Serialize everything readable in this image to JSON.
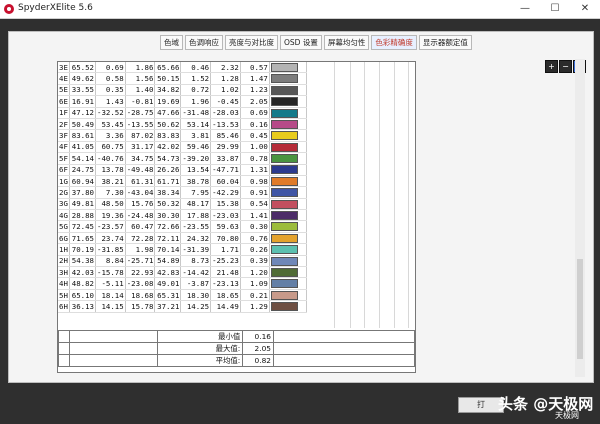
{
  "window": {
    "title": "SpyderXElite 5.6",
    "minimize": "—",
    "maximize": "☐",
    "close": "✕"
  },
  "tabs": [
    {
      "label": "色域"
    },
    {
      "label": "色调响应"
    },
    {
      "label": "亮度与对比度"
    },
    {
      "label": "OSD 设置"
    },
    {
      "label": "屏幕均匀性"
    },
    {
      "label": "色彩精确度",
      "active": true
    },
    {
      "label": "显示器额定值"
    }
  ],
  "zoom": {
    "in": "+",
    "out": "−",
    "fit": "⌕"
  },
  "table": {
    "rows": [
      {
        "id": "3E",
        "v": [
          "65.52",
          "0.69",
          "1.86",
          "65.66",
          "0.46",
          "2.32",
          "0.57"
        ],
        "swatch": "#b4b4b4"
      },
      {
        "id": "4E",
        "v": [
          "49.62",
          "0.58",
          "1.56",
          "50.15",
          "1.52",
          "1.28",
          "1.47"
        ],
        "swatch": "#7d7d7d"
      },
      {
        "id": "5E",
        "v": [
          "33.55",
          "0.35",
          "1.40",
          "34.82",
          "0.72",
          "1.02",
          "1.23"
        ],
        "swatch": "#575757"
      },
      {
        "id": "6E",
        "v": [
          "16.91",
          "1.43",
          "-0.81",
          "19.69",
          "1.96",
          "-0.45",
          "2.05"
        ],
        "swatch": "#262626"
      },
      {
        "id": "1F",
        "v": [
          "47.12",
          "-32.52",
          "-28.75",
          "47.66",
          "-31.48",
          "-28.03",
          "0.69"
        ],
        "swatch": "#137a8a"
      },
      {
        "id": "2F",
        "v": [
          "50.49",
          "53.45",
          "-13.55",
          "50.62",
          "53.14",
          "-13.53",
          "0.16"
        ],
        "swatch": "#b64a88"
      },
      {
        "id": "3F",
        "v": [
          "83.61",
          "3.36",
          "87.02",
          "83.83",
          "3.81",
          "85.46",
          "0.45"
        ],
        "swatch": "#e8cc1d"
      },
      {
        "id": "4F",
        "v": [
          "41.05",
          "60.75",
          "31.17",
          "42.02",
          "59.46",
          "29.99",
          "1.00"
        ],
        "swatch": "#b52b38"
      },
      {
        "id": "5F",
        "v": [
          "54.14",
          "-40.76",
          "34.75",
          "54.73",
          "-39.20",
          "33.87",
          "0.78"
        ],
        "swatch": "#4a9440"
      },
      {
        "id": "6F",
        "v": [
          "24.75",
          "13.78",
          "-49.48",
          "26.26",
          "13.54",
          "-47.71",
          "1.31"
        ],
        "swatch": "#2c3a8e"
      },
      {
        "id": "1G",
        "v": [
          "60.94",
          "38.21",
          "61.31",
          "61.71",
          "38.78",
          "60.04",
          "0.98"
        ],
        "swatch": "#e07b28"
      },
      {
        "id": "2G",
        "v": [
          "37.80",
          "7.30",
          "-43.04",
          "38.34",
          "7.95",
          "-42.29",
          "0.91"
        ],
        "swatch": "#3f55a5"
      },
      {
        "id": "3G",
        "v": [
          "49.81",
          "48.50",
          "15.76",
          "50.32",
          "48.17",
          "15.38",
          "0.54"
        ],
        "swatch": "#c24f5f"
      },
      {
        "id": "4G",
        "v": [
          "28.88",
          "19.36",
          "-24.48",
          "30.30",
          "17.88",
          "-23.03",
          "1.41"
        ],
        "swatch": "#4c2c68"
      },
      {
        "id": "5G",
        "v": [
          "72.45",
          "-23.57",
          "60.47",
          "72.66",
          "-23.55",
          "59.63",
          "0.30"
        ],
        "swatch": "#9cbc3c"
      },
      {
        "id": "6G",
        "v": [
          "71.65",
          "23.74",
          "72.28",
          "72.11",
          "24.32",
          "70.80",
          "0.76"
        ],
        "swatch": "#e4a22c"
      },
      {
        "id": "1H",
        "v": [
          "70.19",
          "-31.85",
          "1.98",
          "70.14",
          "-31.39",
          "1.71",
          "0.26"
        ],
        "swatch": "#5cc0b0"
      },
      {
        "id": "2H",
        "v": [
          "54.38",
          "8.84",
          "-25.71",
          "54.89",
          "8.73",
          "-25.23",
          "0.39"
        ],
        "swatch": "#6f87b8"
      },
      {
        "id": "3H",
        "v": [
          "42.03",
          "-15.78",
          "22.93",
          "42.83",
          "-14.42",
          "21.48",
          "1.20"
        ],
        "swatch": "#506b35"
      },
      {
        "id": "4H",
        "v": [
          "48.82",
          "-5.11",
          "-23.08",
          "49.01",
          "-3.87",
          "-23.13",
          "1.09"
        ],
        "swatch": "#637fa6"
      },
      {
        "id": "5H",
        "v": [
          "65.10",
          "18.14",
          "18.68",
          "65.31",
          "18.30",
          "18.65",
          "0.21"
        ],
        "swatch": "#c89a8a"
      },
      {
        "id": "6H",
        "v": [
          "36.13",
          "14.15",
          "15.78",
          "37.21",
          "14.25",
          "14.49",
          "1.29"
        ],
        "swatch": "#6e4f42"
      }
    ]
  },
  "summary": [
    {
      "label": "最小值",
      "value": "0.16"
    },
    {
      "label": "最大值:",
      "value": "2.05"
    },
    {
      "label": "平均值:",
      "value": "0.82"
    }
  ],
  "watermark": {
    "button": "打",
    "text": "头条 @天极网",
    "sub": "天极网"
  }
}
